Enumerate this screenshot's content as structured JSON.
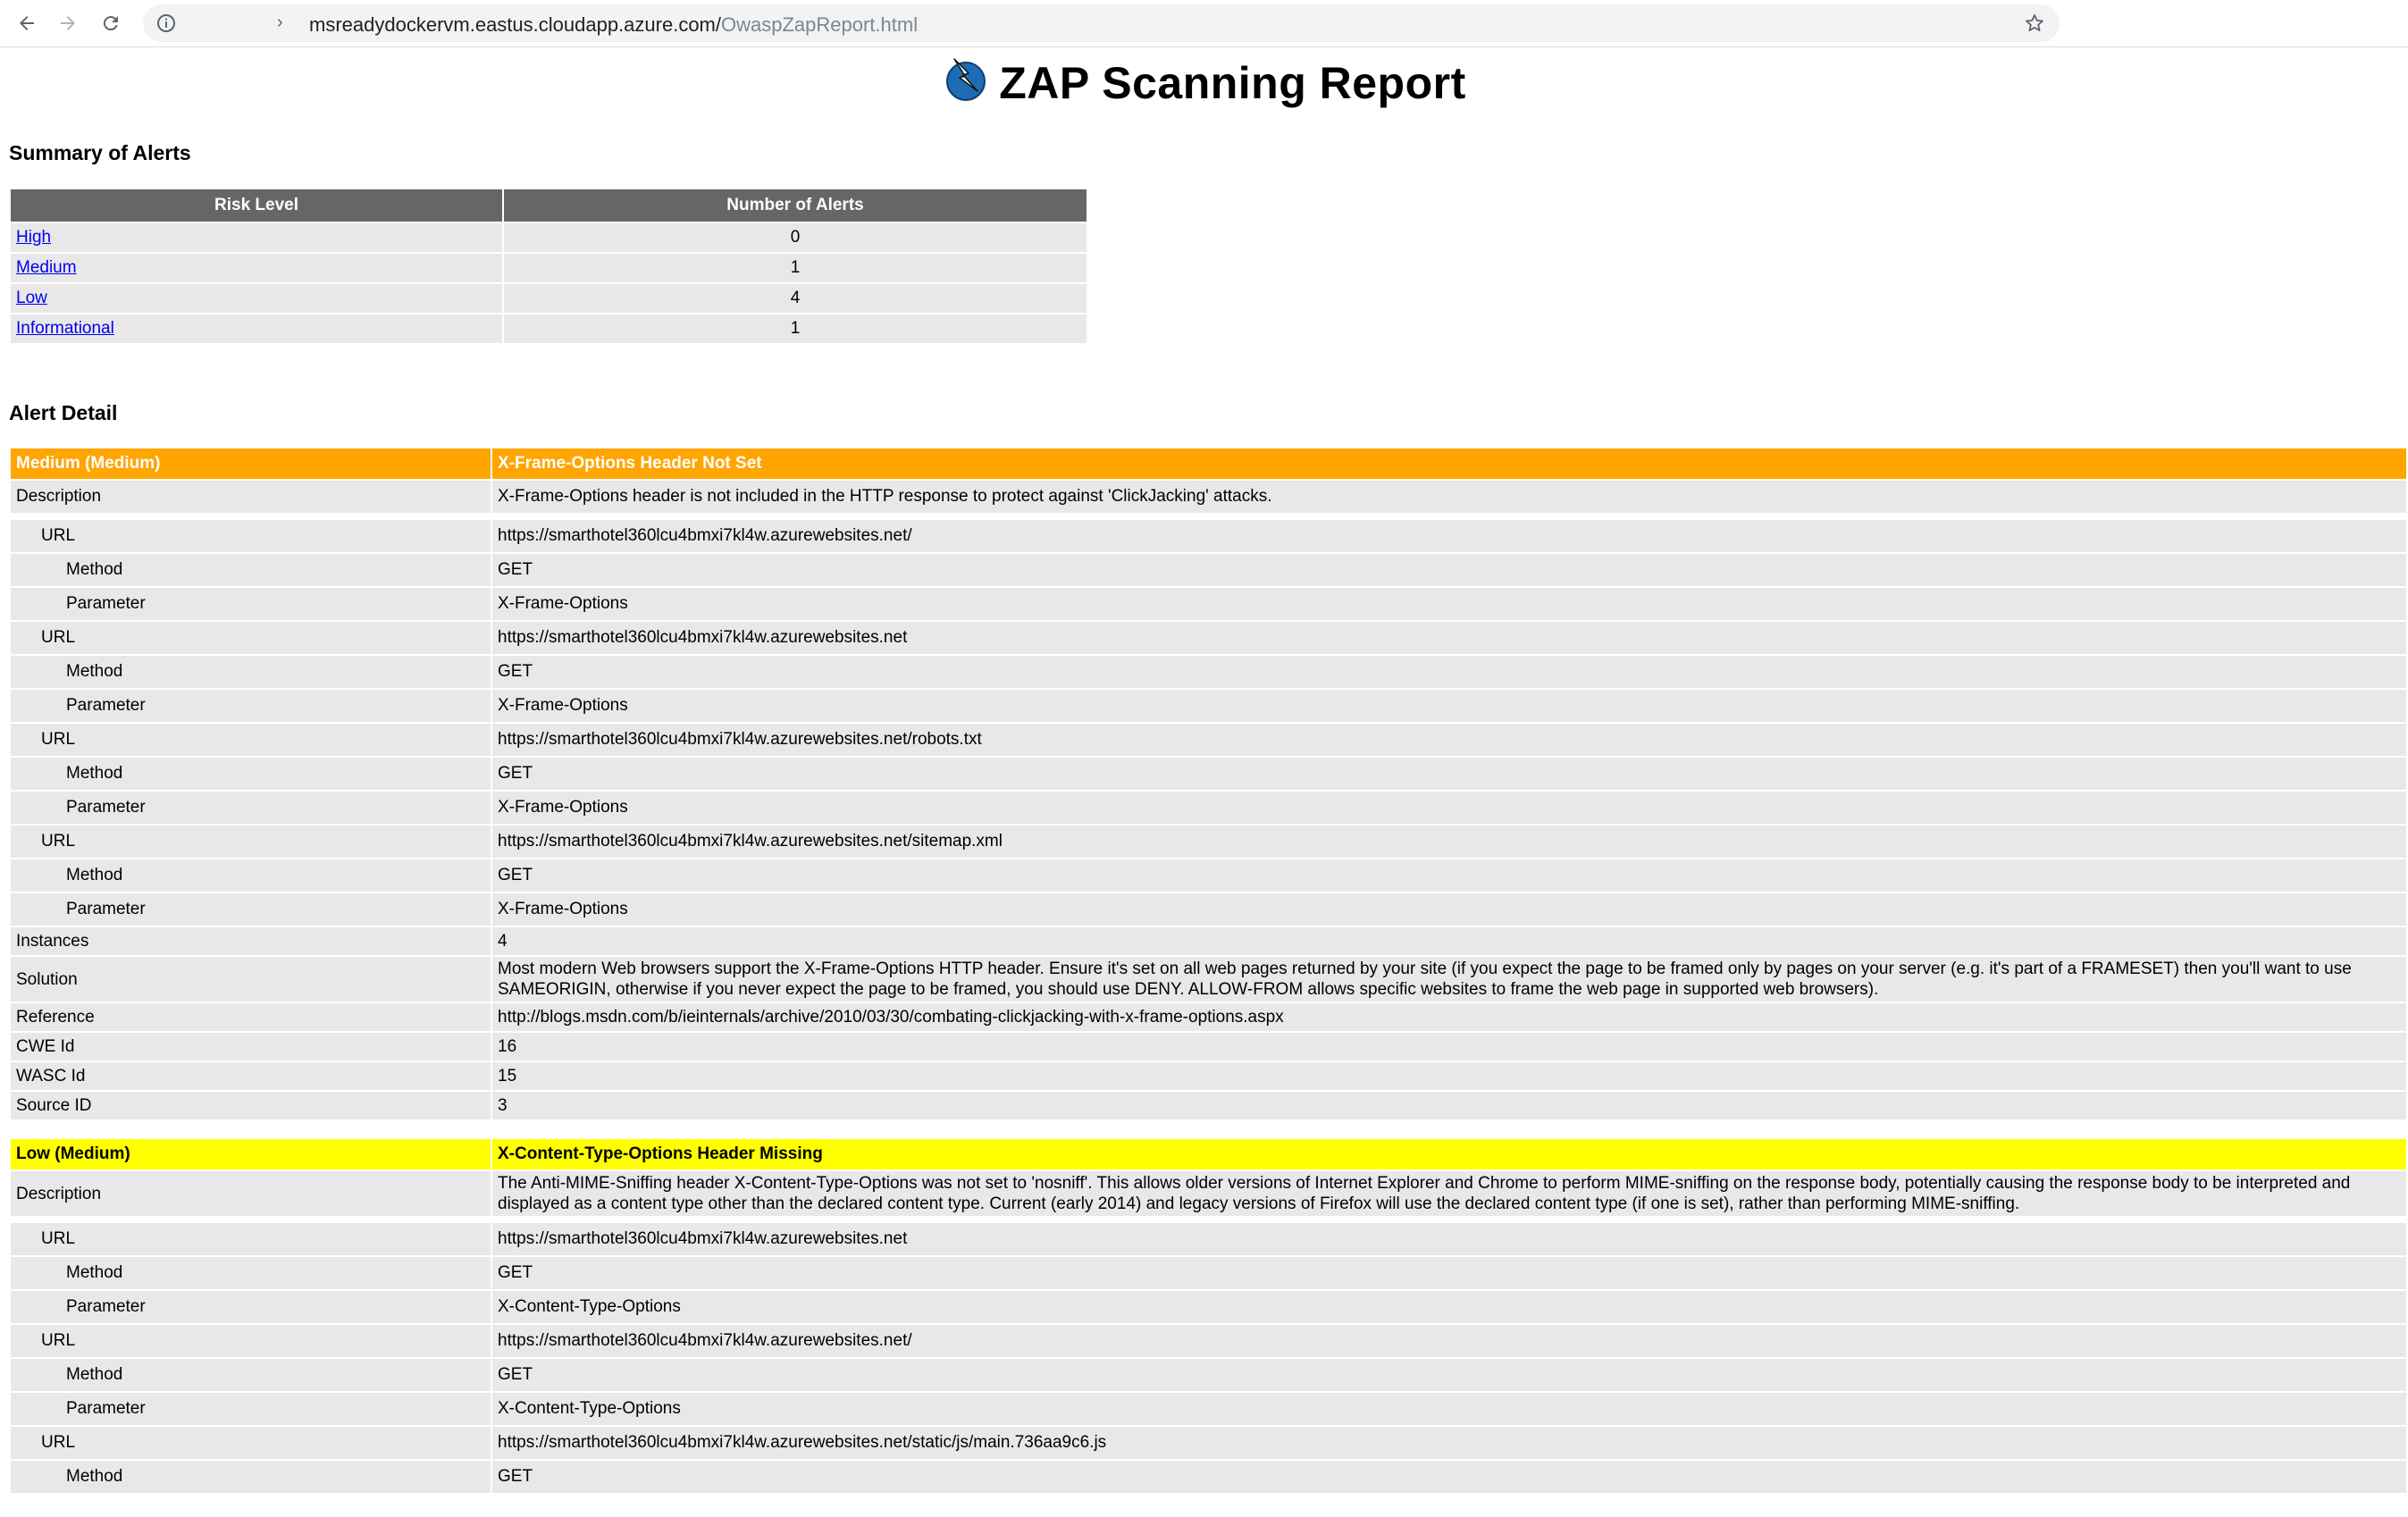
{
  "browser": {
    "url_host": "msreadydockervm.eastus.cloudapp.azure.com/",
    "url_path": "OwaspZapReport.html",
    "sep": "›"
  },
  "report": {
    "title": "ZAP Scanning Report"
  },
  "summary": {
    "heading": "Summary of Alerts",
    "col_risk": "Risk Level",
    "col_count": "Number of Alerts",
    "rows": [
      {
        "level": "High",
        "count": "0"
      },
      {
        "level": "Medium",
        "count": "1"
      },
      {
        "level": "Low",
        "count": "4"
      },
      {
        "level": "Informational",
        "count": "1"
      }
    ]
  },
  "detail": {
    "heading": "Alert Detail",
    "labels": {
      "description": "Description",
      "url": "URL",
      "method": "Method",
      "parameter": "Parameter",
      "instances": "Instances",
      "solution": "Solution",
      "reference": "Reference",
      "cwe": "CWE Id",
      "wasc": "WASC Id",
      "source": "Source ID"
    },
    "alert1": {
      "risk": "Medium (Medium)",
      "name": "X-Frame-Options Header Not Set",
      "description": "X-Frame-Options header is not included in the HTTP response to protect against 'ClickJacking' attacks.",
      "instances_list": [
        {
          "url": "https://smarthotel360lcu4bmxi7kl4w.azurewebsites.net/",
          "method": "GET",
          "parameter": "X-Frame-Options"
        },
        {
          "url": "https://smarthotel360lcu4bmxi7kl4w.azurewebsites.net",
          "method": "GET",
          "parameter": "X-Frame-Options"
        },
        {
          "url": "https://smarthotel360lcu4bmxi7kl4w.azurewebsites.net/robots.txt",
          "method": "GET",
          "parameter": "X-Frame-Options"
        },
        {
          "url": "https://smarthotel360lcu4bmxi7kl4w.azurewebsites.net/sitemap.xml",
          "method": "GET",
          "parameter": "X-Frame-Options"
        }
      ],
      "instances": "4",
      "solution": "Most modern Web browsers support the X-Frame-Options HTTP header. Ensure it's set on all web pages returned by your site (if you expect the page to be framed only by pages on your server (e.g. it's part of a FRAMESET) then you'll want to use SAMEORIGIN, otherwise if you never expect the page to be framed, you should use DENY. ALLOW-FROM allows specific websites to frame the web page in supported web browsers).",
      "reference": "http://blogs.msdn.com/b/ieinternals/archive/2010/03/30/combating-clickjacking-with-x-frame-options.aspx",
      "cwe": "16",
      "wasc": "15",
      "source": "3"
    },
    "alert2": {
      "risk": "Low (Medium)",
      "name": "X-Content-Type-Options Header Missing",
      "description": "The Anti-MIME-Sniffing header X-Content-Type-Options was not set to 'nosniff'. This allows older versions of Internet Explorer and Chrome to perform MIME-sniffing on the response body, potentially causing the response body to be interpreted and displayed as a content type other than the declared content type. Current (early 2014) and legacy versions of Firefox will use the declared content type (if one is set), rather than performing MIME-sniffing.",
      "instances_list": [
        {
          "url": "https://smarthotel360lcu4bmxi7kl4w.azurewebsites.net",
          "method": "GET",
          "parameter": "X-Content-Type-Options"
        },
        {
          "url": "https://smarthotel360lcu4bmxi7kl4w.azurewebsites.net/",
          "method": "GET",
          "parameter": "X-Content-Type-Options"
        },
        {
          "url": "https://smarthotel360lcu4bmxi7kl4w.azurewebsites.net/static/js/main.736aa9c6.js",
          "method": "GET"
        }
      ]
    }
  },
  "colors": {
    "medium": "#ffa500",
    "low": "#ffff00",
    "header": "#666666",
    "cell": "#e8e8e8"
  }
}
